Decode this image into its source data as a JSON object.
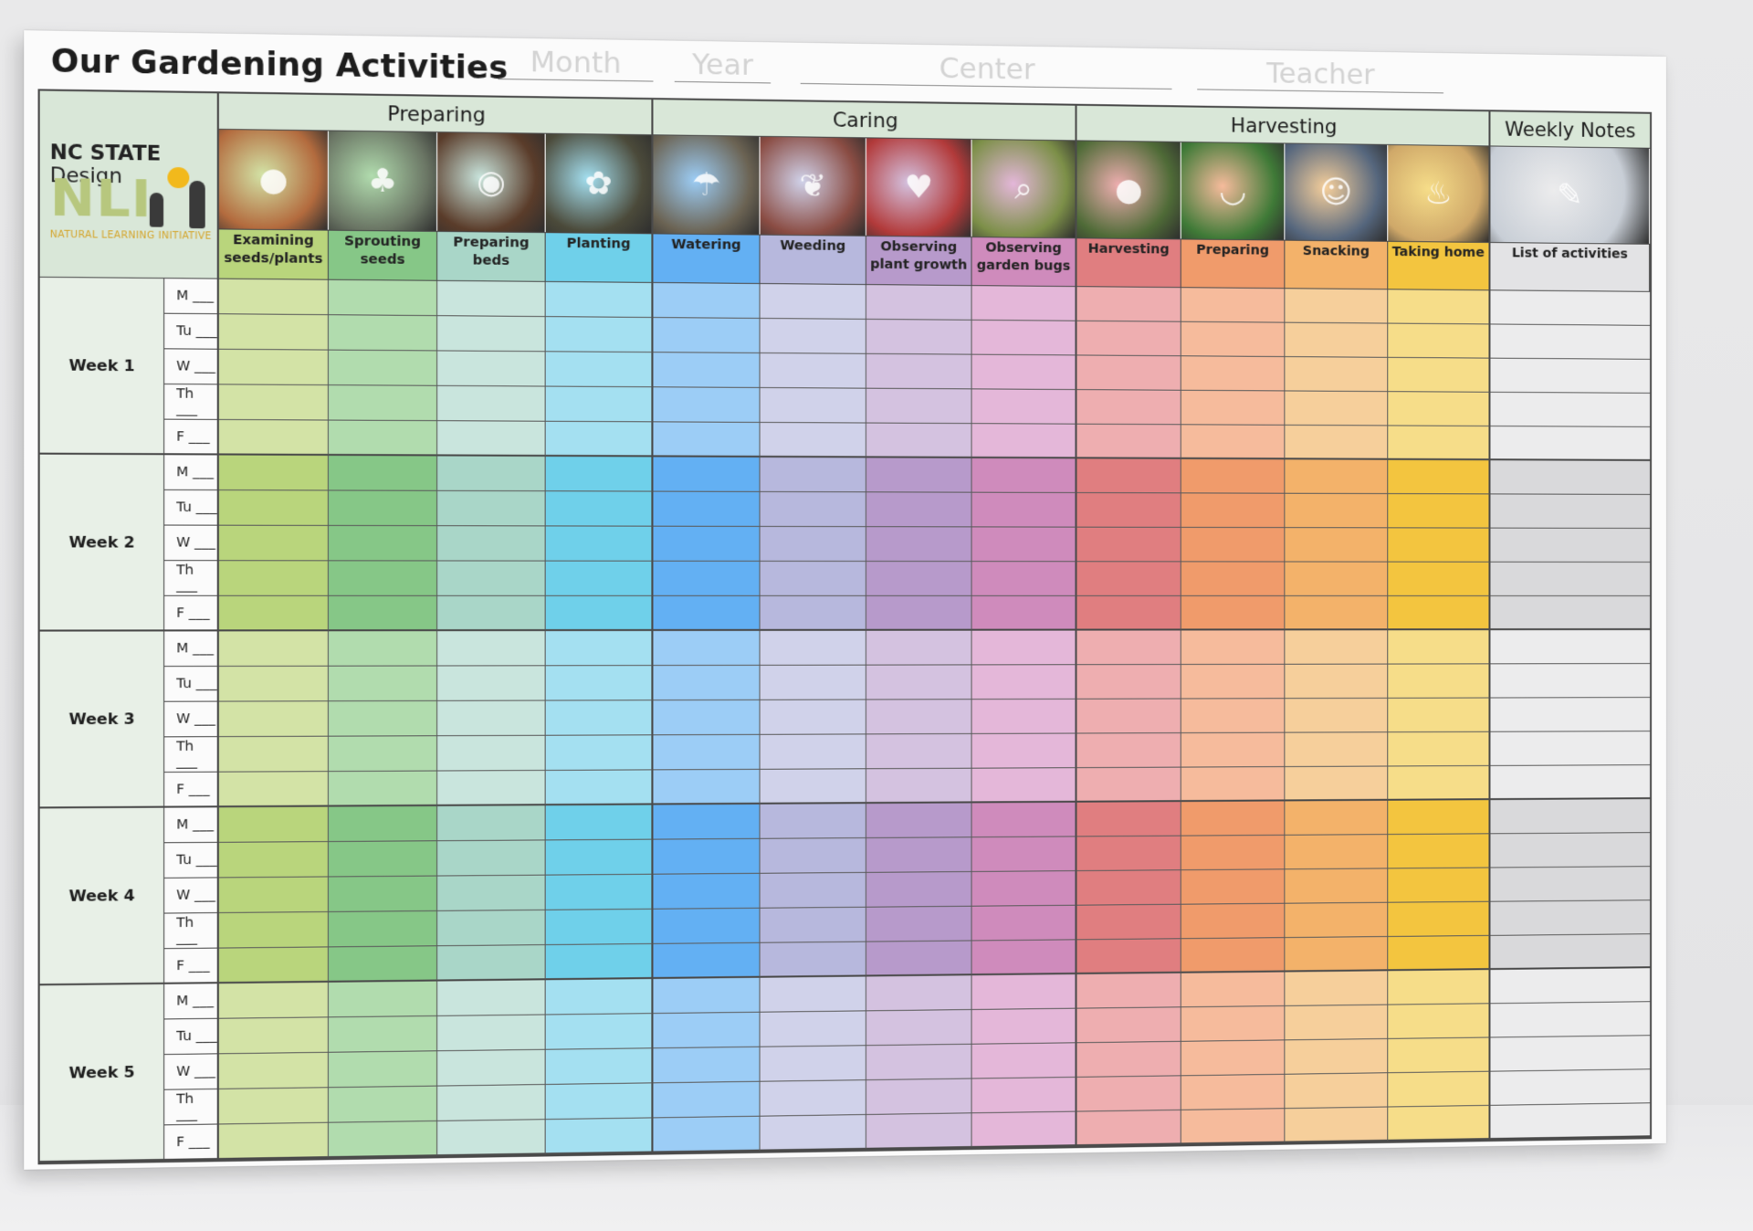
{
  "header": {
    "title": "Our Gardening Activities",
    "blanks": [
      "Month",
      "Year",
      "Center",
      "Teacher"
    ]
  },
  "logo": {
    "top_bold": "NC STATE",
    "top_thin": "Design",
    "main": "NLI",
    "sub": "NATURAL LEARNING INITIATIVE"
  },
  "groups": [
    "Preparing",
    "Caring",
    "Harvesting",
    "Weekly Notes"
  ],
  "activities": [
    {
      "label": "Examining seeds/plants",
      "color": "#d3e3a6",
      "strong": "#b9d57c",
      "photo": "#b36b3e",
      "icon": "seed-icon"
    },
    {
      "label": "Sprouting seeds",
      "color": "#b1dcae",
      "strong": "#86c787",
      "photo": "#6a7564",
      "icon": "sprout-icon"
    },
    {
      "label": "Preparing beds",
      "color": "#c9e5dd",
      "strong": "#a9d6c8",
      "photo": "#5a3c2a",
      "icon": "soil-icon"
    },
    {
      "label": "Planting",
      "color": "#a4e0f1",
      "strong": "#6fd0ea",
      "photo": "#4b4a3a",
      "icon": "plant-icon"
    },
    {
      "label": "Watering",
      "color": "#9ccdf6",
      "strong": "#63b0f3",
      "photo": "#6b6353",
      "icon": "watering-icon"
    },
    {
      "label": "Weeding",
      "color": "#d0d2ea",
      "strong": "#b7b8dd",
      "photo": "#8a4c43",
      "icon": "weed-icon"
    },
    {
      "label": "Observing plant growth",
      "color": "#d4c2e0",
      "strong": "#b79acb",
      "photo": "#b23a3a",
      "icon": "strawberry-icon"
    },
    {
      "label": "Observing garden bugs",
      "color": "#e4b7d9",
      "strong": "#cf8bbc",
      "photo": "#7c8f48",
      "icon": "magnifier-icon"
    },
    {
      "label": "Harvesting",
      "color": "#eeaeb0",
      "strong": "#e07e80",
      "photo": "#4f6b37",
      "icon": "tomato-icon"
    },
    {
      "label": "Preparing",
      "color": "#f6bb9c",
      "strong": "#f09b6b",
      "photo": "#3f7a37",
      "icon": "bowl-icon"
    },
    {
      "label": "Snacking",
      "color": "#f6cf9b",
      "strong": "#f3b26a",
      "photo": "#55667d",
      "icon": "snack-icon"
    },
    {
      "label": "Taking home",
      "color": "#f6dd89",
      "strong": "#f3c53f",
      "photo": "#cfa869",
      "icon": "basket-icon"
    },
    {
      "label": "List of activities",
      "color": "#ececed",
      "strong": "#d9d9db",
      "photo": "#c8ced6",
      "icon": "writing-icon"
    }
  ],
  "weeks": [
    "Week 1",
    "Week 2",
    "Week 3",
    "Week 4",
    "Week 5"
  ],
  "days": [
    "M ___",
    "Tu ___",
    "W ___",
    "Th ___",
    "F ___"
  ]
}
